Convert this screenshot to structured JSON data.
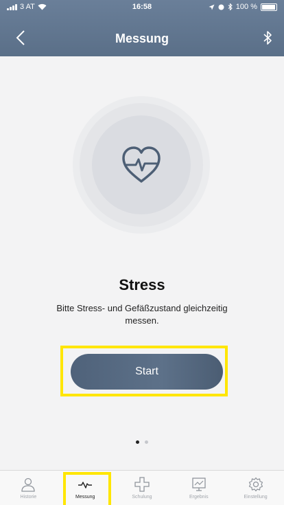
{
  "status_bar": {
    "carrier": "3 AT",
    "time": "16:58",
    "battery_text": "100 %"
  },
  "nav": {
    "title": "Messung"
  },
  "measurement": {
    "title": "Stress",
    "description": "Bitte Stress-  und Gefäßzustand gleichzeitig messen.",
    "start_label": "Start"
  },
  "pager": {
    "count": 2,
    "active_index": 0
  },
  "tabs": [
    {
      "label": "Historie",
      "icon": "person-icon",
      "active": false
    },
    {
      "label": "Messung",
      "icon": "pulse-icon",
      "active": true
    },
    {
      "label": "Schulung",
      "icon": "cross-icon",
      "active": false
    },
    {
      "label": "Ergebnis",
      "icon": "monitor-icon",
      "active": false
    },
    {
      "label": "Einstellung",
      "icon": "gear-icon",
      "active": false
    }
  ],
  "colors": {
    "header": "#5f748e",
    "button": "#55687f",
    "highlight": "#ffe600"
  }
}
